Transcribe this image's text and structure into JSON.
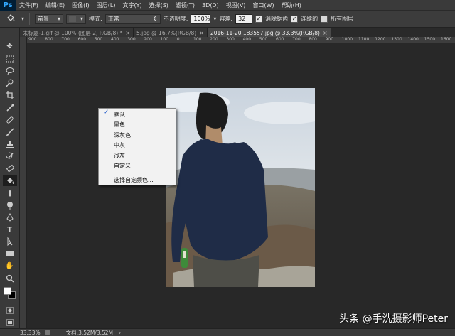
{
  "app": {
    "logo": "Ps"
  },
  "menu": [
    "文件(F)",
    "编辑(E)",
    "图像(I)",
    "图层(L)",
    "文字(Y)",
    "选择(S)",
    "滤镜(T)",
    "3D(D)",
    "视图(V)",
    "窗口(W)",
    "帮助(H)"
  ],
  "options": {
    "fill_source": "前景",
    "mode_label": "模式:",
    "mode_value": "正常",
    "opacity_label": "不透明度:",
    "opacity_value": "100%",
    "tolerance_label": "容差:",
    "tolerance_value": "32",
    "antialias_label": "消除锯齿",
    "contiguous_label": "连续的",
    "all_layers_label": "所有图层"
  },
  "tabs": [
    {
      "label": "未标题-1.gif @ 100% (图层 2, RGB/8) *"
    },
    {
      "label": "5.jpg @ 16.7%(RGB/8)"
    },
    {
      "label": "2016-11-20 183557.jpg @ 33.3%(RGB/8)"
    }
  ],
  "ruler": [
    "900",
    "800",
    "700",
    "600",
    "500",
    "400",
    "300",
    "200",
    "100",
    "0",
    "100",
    "200",
    "300",
    "400",
    "500",
    "600",
    "700",
    "800",
    "900",
    "1000",
    "1100",
    "1200",
    "1300",
    "1400",
    "1500",
    "1600"
  ],
  "dropdown": {
    "items": [
      {
        "label": "默认",
        "checked": true
      },
      {
        "label": "黑色",
        "checked": false
      },
      {
        "label": "深灰色",
        "checked": false
      },
      {
        "label": "中灰",
        "checked": false
      },
      {
        "label": "浅灰",
        "checked": false
      },
      {
        "label": "自定义",
        "checked": false
      }
    ],
    "custom": "选择自定颜色..."
  },
  "status": {
    "zoom": "33.33%",
    "doc": "文档:3.52M/3.52M"
  },
  "watermark": "头条 @手洗摄影师Peter",
  "colors": {
    "accent": "#31a8ff",
    "check": "#1a56c8"
  }
}
